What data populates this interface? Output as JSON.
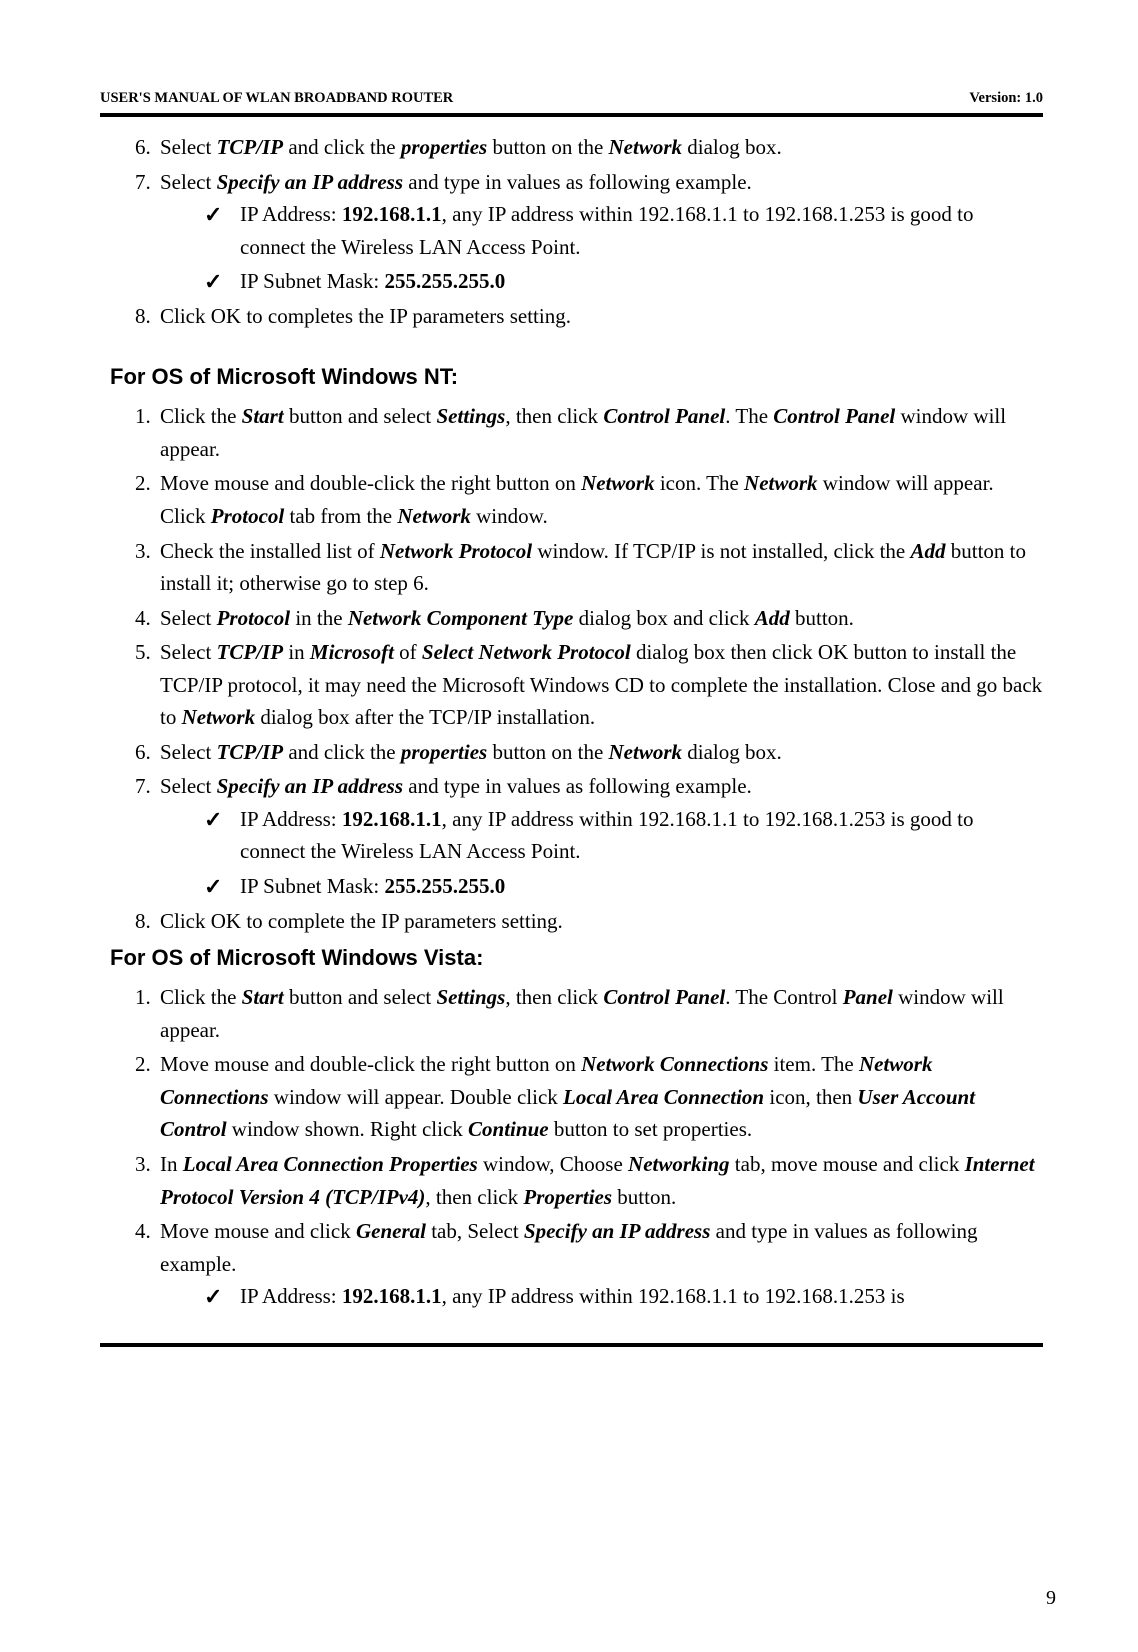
{
  "header": {
    "left": "USER'S MANUAL OF WLAN BROADBAND ROUTER",
    "right": "Version: 1.0"
  },
  "footer": {
    "page": "9"
  },
  "blocks": {
    "a6": {
      "pre": "Select ",
      "tcpip": "TCP/IP",
      "mid1": " and click the ",
      "props": "properties",
      "mid2": " button on the ",
      "net": "Network",
      "end": " dialog box."
    },
    "a7": {
      "pre": "Select ",
      "spec": "Specify an IP address",
      "end": " and type in values as following example."
    },
    "a7c1": {
      "pre": "IP Address: ",
      "ip": "192.168.1.1",
      "rest": ", any IP address within 192.168.1.1 to 192.168.1.253 is good to connect the Wireless LAN Access Point."
    },
    "a7c2": {
      "pre": "IP Subnet Mask: ",
      "mask": "255.255.255.0"
    },
    "a8": "Click OK to completes the IP parameters setting.",
    "ntTitle": "For OS of Microsoft Windows NT:",
    "n1": {
      "a": "Click the ",
      "start": "Start",
      "b": " button and select ",
      "set": "Settings",
      "c": ", then click ",
      "cp": "Control Panel",
      "d": ". The ",
      "cp2": "Control Panel",
      "e": " window will appear."
    },
    "n2": {
      "a": "Move mouse and double-click the right button on ",
      "net": "Network",
      "b": " icon. The ",
      "net2": "Network",
      "c": " window will appear. Click ",
      "proto": "Protocol",
      "d": " tab from the ",
      "net3": "Network",
      "e": " window."
    },
    "n3": {
      "a": "Check the installed list of ",
      "np": "Network Protocol",
      "b": " window. If TCP/IP is not installed, click the ",
      "add": "Add",
      "c": " button to install it; otherwise go to step 6."
    },
    "n4": {
      "a": "Select ",
      "proto": "Protocol",
      "b": " in the ",
      "nct": "Network Component Type",
      "c": " dialog box and click ",
      "add": "Add",
      "d": " button."
    },
    "n5": {
      "a": "Select ",
      "tcp": "TCP/IP",
      "b": " in ",
      "ms": "Microsoft",
      "c": " of ",
      "snp": "Select Network Protocol",
      "d": " dialog box then click OK button to install the TCP/IP protocol, it may need the Microsoft Windows CD to complete the installation. Close and go back to ",
      "net": "Network",
      "e": " dialog box after the TCP/IP installation."
    },
    "n6": {
      "a": "Select ",
      "tcp": "TCP/IP",
      "b": " and click the ",
      "props": "properties",
      "c": " button on the ",
      "net": "Network",
      "d": " dialog box."
    },
    "n7": {
      "a": "Select ",
      "spec": "Specify an IP address",
      "b": " and type in values as following example."
    },
    "n7c1": {
      "pre": "IP Address: ",
      "ip": "192.168.1.1",
      "rest": ", any IP address within 192.168.1.1 to 192.168.1.253 is good to connect the Wireless LAN Access Point."
    },
    "n7c2": {
      "pre": "IP Subnet Mask: ",
      "mask": "255.255.255.0"
    },
    "n8": "Click OK to complete the IP parameters setting.",
    "vistaTitle": "For OS of Microsoft Windows Vista:",
    "v1": {
      "a": "Click the ",
      "start": "Start",
      "b": " button and select ",
      "set": "Settings",
      "c": ", then click ",
      "cp": "Control Panel",
      "d": ". The Control ",
      "panel": "Panel",
      "e": " window will appear."
    },
    "v2": {
      "a": "Move mouse and double-click the right button on ",
      "nc": "Network Connections",
      "b": " item. The ",
      "nc2": "Network Connections",
      "c": " window will appear. Double click ",
      "lac": "Local Area Connection",
      "d": " icon, then ",
      "uac": "User Account Control",
      "e": " window shown. Right click ",
      "cont": "Continue",
      "f": " button to set properties."
    },
    "v3": {
      "a": "In ",
      "lacp": "Local Area Connection Properties",
      "b": " window, Choose ",
      "netw": "Networking",
      "c": " tab, move mouse and click ",
      "ipv4": "Internet Protocol Version 4 (TCP/IPv4)",
      "d": ", then click ",
      "props": "Properties",
      "e": " button."
    },
    "v4": {
      "a": "Move mouse and click ",
      "gen": "General",
      "b": " tab, Select ",
      "spec": "Specify an IP address",
      "c": " and type in values as following example."
    },
    "v4c1": {
      "pre": "IP Address: ",
      "ip": "192.168.1.1",
      "rest": ", any IP address within 192.168.1.1 to 192.168.1.253 is"
    }
  }
}
